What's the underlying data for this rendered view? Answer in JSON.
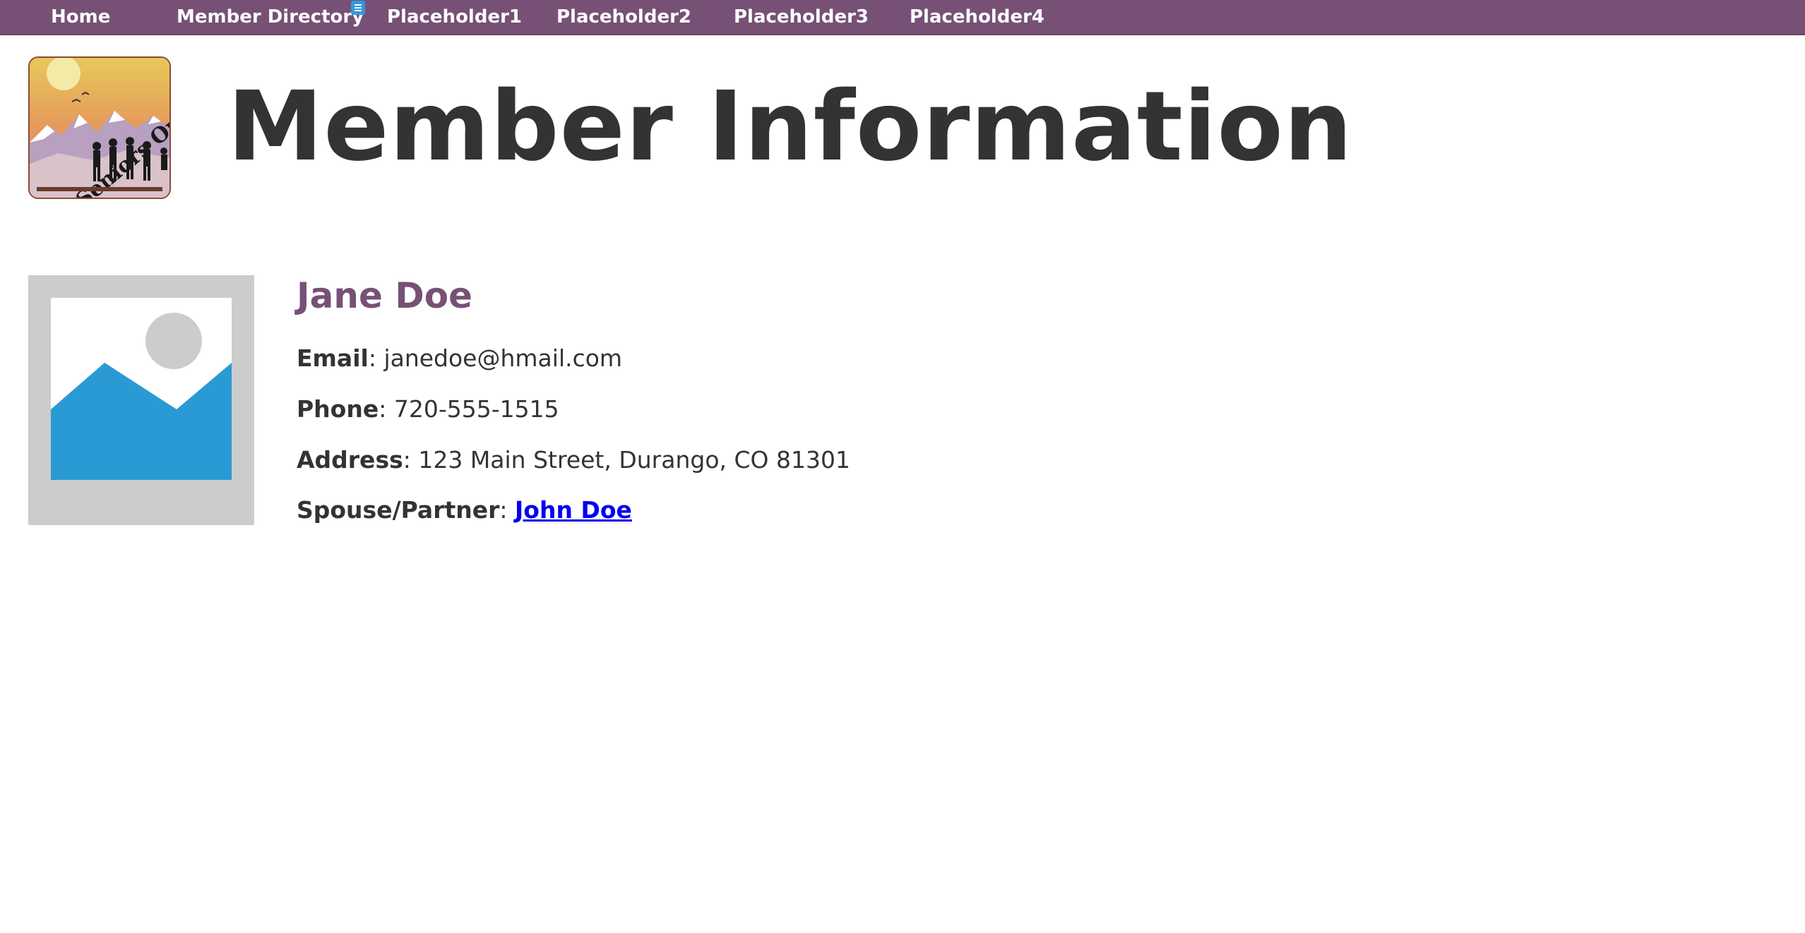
{
  "nav": {
    "items": [
      {
        "label": "Home"
      },
      {
        "label": "Member Directory"
      },
      {
        "label": "Placeholder1"
      },
      {
        "label": "Placeholder2"
      },
      {
        "label": "Placeholder3"
      },
      {
        "label": "Placeholder4"
      }
    ],
    "menu_icon": "hamburger-menu-icon"
  },
  "logo": {
    "text": "Seniors Outdoors!",
    "icon": "seniors-outdoors-logo"
  },
  "header": {
    "title": "Member Information"
  },
  "member": {
    "photo_icon": "image-placeholder-icon",
    "name": "Jane Doe",
    "fields": [
      {
        "label": "Email",
        "separator": ": ",
        "value": "janedoe@hmail.com"
      },
      {
        "label": "Phone",
        "separator": ": ",
        "value": "720-555-1515"
      },
      {
        "label": "Address",
        "separator": ": ",
        "value": "123 Main Street, Durango, CO 81301"
      }
    ],
    "spouse": {
      "label": "Spouse/Partner",
      "separator": ": ",
      "link_text": "John Doe"
    }
  },
  "colors": {
    "nav_background": "#765175",
    "name_color": "#765175",
    "link_color": "#0000ee",
    "placeholder_frame": "#cccccc",
    "placeholder_mountain": "#2a9ad4"
  }
}
